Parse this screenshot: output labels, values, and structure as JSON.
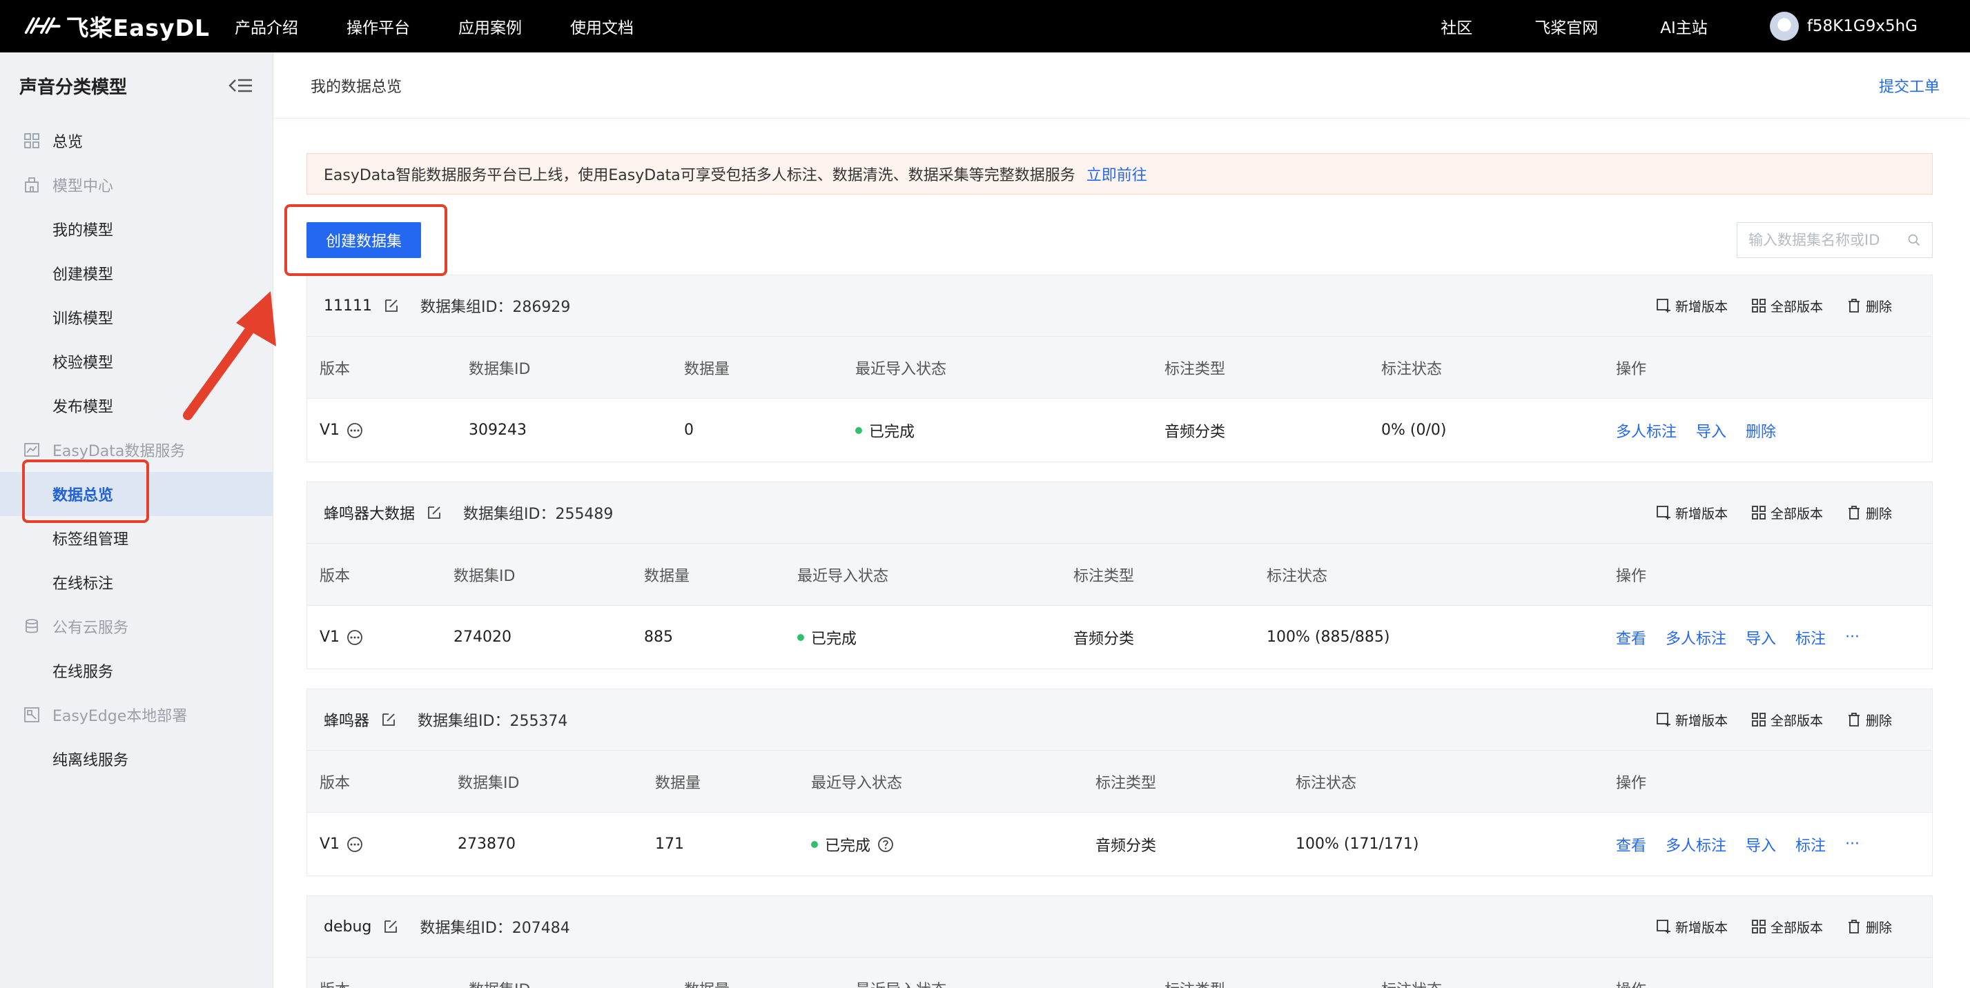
{
  "topnav": {
    "brand": "飞桨EasyDL",
    "links": [
      "产品介绍",
      "操作平台",
      "应用案例",
      "使用文档"
    ],
    "right_links": [
      "社区",
      "飞桨官网",
      "AI主站"
    ],
    "username": "f58K1G9x5hG"
  },
  "sidebar": {
    "title": "声音分类模型",
    "overview": "总览",
    "groups": [
      {
        "label": "模型中心",
        "icon": "building-icon",
        "items": [
          "我的模型",
          "创建模型",
          "训练模型",
          "校验模型",
          "发布模型"
        ]
      },
      {
        "label": "EasyData数据服务",
        "icon": "chart-icon",
        "items": [
          "数据总览",
          "标签组管理",
          "在线标注"
        ]
      },
      {
        "label": "公有云服务",
        "icon": "database-icon",
        "items": [
          "在线服务"
        ]
      },
      {
        "label": "EasyEdge本地部署",
        "icon": "edge-icon",
        "items": [
          "纯离线服务"
        ]
      }
    ],
    "active_item": "数据总览"
  },
  "header": {
    "breadcrumb": "我的数据总览",
    "ticket_link": "提交工单"
  },
  "notice": {
    "text": "EasyData智能数据服务平台已上线，使用EasyData可享受包括多人标注、数据清洗、数据采集等完整数据服务",
    "link": "立即前往"
  },
  "toolbar": {
    "create_label": "创建数据集",
    "search_placeholder": "输入数据集名称或ID"
  },
  "dataset_actions": [
    "新增版本",
    "全部版本",
    "删除"
  ],
  "table_columns": [
    "版本",
    "数据集ID",
    "数据量",
    "最近导入状态",
    "标注类型",
    "标注状态",
    "操作"
  ],
  "datasets": [
    {
      "name": "11111",
      "group_id": "数据集组ID：286929",
      "row": {
        "version": "V1",
        "dataset_id": "309243",
        "count": "0",
        "import_status": "已完成",
        "label_type": "音频分类",
        "label_status": "0% (0/0)",
        "ops": [
          "多人标注",
          "导入",
          "删除"
        ]
      }
    },
    {
      "name": "蜂鸣器大数据",
      "group_id": "数据集组ID：255489",
      "row": {
        "version": "V1",
        "dataset_id": "274020",
        "count": "885",
        "import_status": "已完成",
        "label_type": "音频分类",
        "label_status": "100% (885/885)",
        "ops": [
          "查看",
          "多人标注",
          "导入",
          "标注",
          "···"
        ]
      }
    },
    {
      "name": "蜂鸣器",
      "group_id": "数据集组ID：255374",
      "row": {
        "version": "V1",
        "dataset_id": "273870",
        "count": "171",
        "import_status": "已完成",
        "label_type": "音频分类",
        "label_status": "100% (171/171)",
        "ops": [
          "查看",
          "多人标注",
          "导入",
          "标注",
          "···"
        ]
      }
    },
    {
      "name": "debug",
      "group_id": "数据集组ID：207484",
      "row": null
    }
  ]
}
